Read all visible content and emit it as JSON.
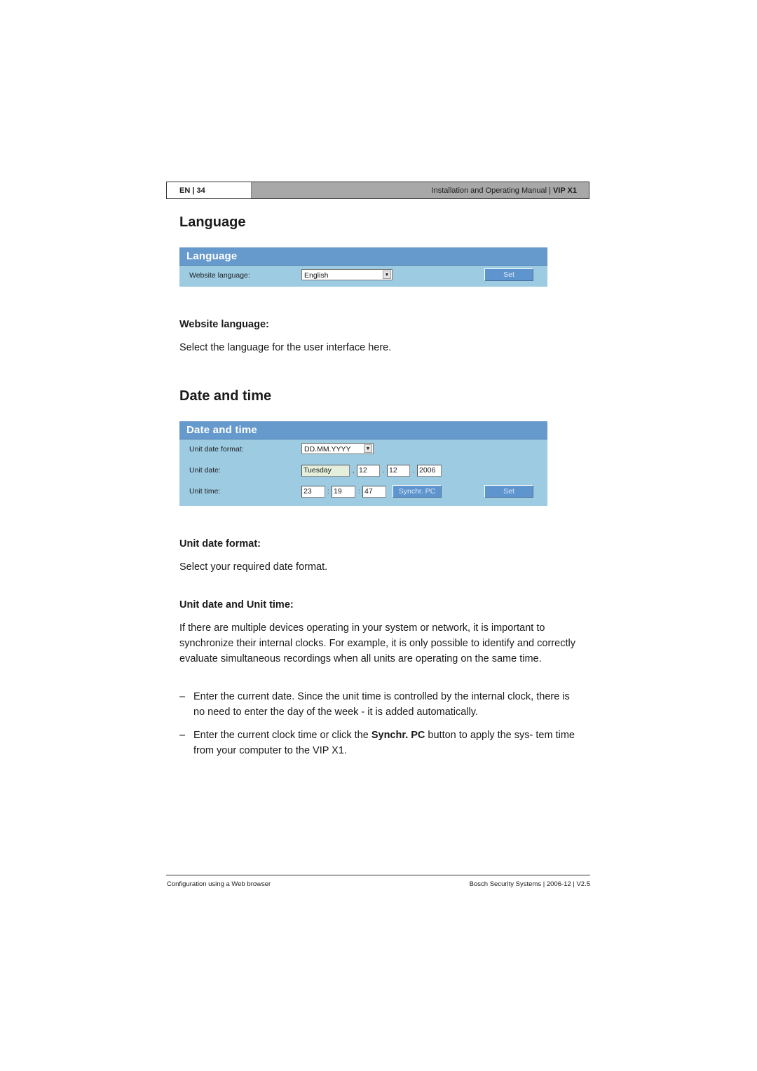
{
  "header": {
    "lang_page": "EN | 34",
    "manual_title": "Installation and Operating Manual |",
    "product": "VIP X1"
  },
  "language_section": {
    "title": "Language",
    "panel": {
      "title": "Language",
      "website_language_label": "Website language:",
      "website_language_value": "English",
      "set_button": "Set"
    },
    "subheading": "Website language:",
    "description": "Select the language for the user interface here."
  },
  "datetime_section": {
    "title": "Date and time",
    "panel": {
      "title": "Date and time",
      "unit_date_format_label": "Unit date format:",
      "unit_date_format_value": "DD.MM.YYYY",
      "unit_date_label": "Unit date:",
      "weekday": "Tuesday",
      "day": "12",
      "month": "12",
      "year": "2006",
      "date_sep1": ",",
      "date_sep2": ".",
      "date_sep3": ".",
      "unit_time_label": "Unit time:",
      "hours": "23",
      "minutes": "19",
      "seconds": "47",
      "time_sep": ":",
      "synchr_button": "Synchr. PC",
      "set_button": "Set"
    },
    "format_heading": "Unit date format:",
    "format_description": "Select your required date format.",
    "date_time_heading": "Unit date and Unit time:",
    "intro_paragraph": "If there are multiple devices operating in your system or network, it is important to synchronize their internal clocks. For example, it is only possible to identify and correctly evaluate simultaneous recordings when all units are operating on the same time.",
    "bullets": [
      {
        "dash": "–",
        "text": "Enter the current date. Since the unit time is controlled by the internal clock, there is no need to enter the day of the week - it is added automatically."
      },
      {
        "dash": "–",
        "pre": "Enter the current clock time or click the ",
        "bold": "Synchr. PC",
        "post": " button to apply the sys- tem time from your computer to the VIP X1."
      }
    ]
  },
  "footer": {
    "left": "Configuration using a Web browser",
    "right": "Bosch Security Systems | 2006-12 | V2.5"
  },
  "icons": {
    "dropdown_arrow": "▼"
  },
  "colors": {
    "panel_header": "#6699cc",
    "panel_body": "#9ccbe2",
    "button": "#5f95cf"
  }
}
